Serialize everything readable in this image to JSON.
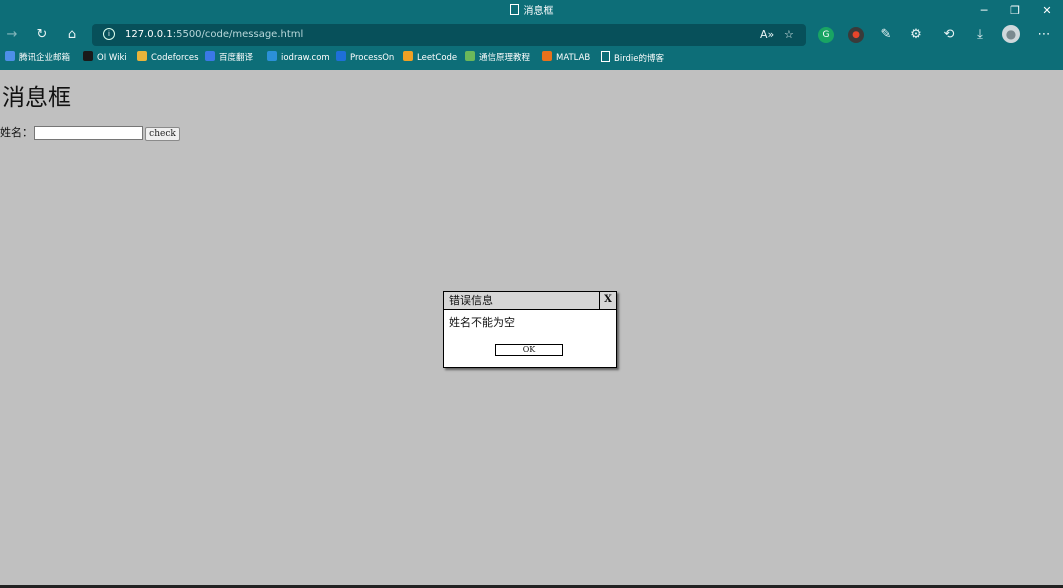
{
  "window": {
    "title": "消息框",
    "minimize_glyph": "─",
    "restore_glyph": "❐",
    "close_glyph": "✕"
  },
  "nav": {
    "back_glyph": "→",
    "refresh_glyph": "↻",
    "home_glyph": "⌂",
    "url_host": "127.0.0.1",
    "url_rest": ":5500/code/message.html",
    "read_aloud_glyph": "A»",
    "favorite_glyph": "☆",
    "history_glyph": "⟲",
    "download_glyph": "⤓",
    "menu_glyph": "⋯",
    "extensions_glyph": "⚙"
  },
  "extensions": {
    "grammarly_label": "G",
    "record_label": "●",
    "sketch_label": "✎"
  },
  "colors": {
    "chrome": "#0d6e78",
    "page_background": "#c0c0c0",
    "dialog_header": "#d6d6d6"
  },
  "bookmarks": [
    {
      "label": "腾讯企业邮箱",
      "icon": "mail-icon",
      "color": "#4d8fe8"
    },
    {
      "label": "OI Wiki",
      "icon": "oi-wiki-icon",
      "color": "#1a1a1a"
    },
    {
      "label": "Codeforces",
      "icon": "codeforces-icon",
      "color": "#e9b43a"
    },
    {
      "label": "百度翻译",
      "icon": "baidu-translate-icon",
      "color": "#3b78e7"
    },
    {
      "label": "iodraw.com",
      "icon": "iodraw-icon",
      "color": "#2b90d9"
    },
    {
      "label": "ProcessOn",
      "icon": "processon-icon",
      "color": "#1e6fd9"
    },
    {
      "label": "LeetCode",
      "icon": "leetcode-icon",
      "color": "#f0a023"
    },
    {
      "label": "通信原理教程",
      "icon": "book-icon",
      "color": "#6bb85a"
    },
    {
      "label": "MATLAB",
      "icon": "matlab-icon",
      "color": "#e8711c"
    },
    {
      "label": "Birdie的博客",
      "icon": "page-icon",
      "color": "#ffffff"
    }
  ],
  "page": {
    "heading": "消息框",
    "name_label": "姓名：",
    "name_value": "",
    "check_label": "check"
  },
  "dialog": {
    "title": "错误信息",
    "close_label": "X",
    "message": "姓名不能为空",
    "ok_label": "OK"
  }
}
